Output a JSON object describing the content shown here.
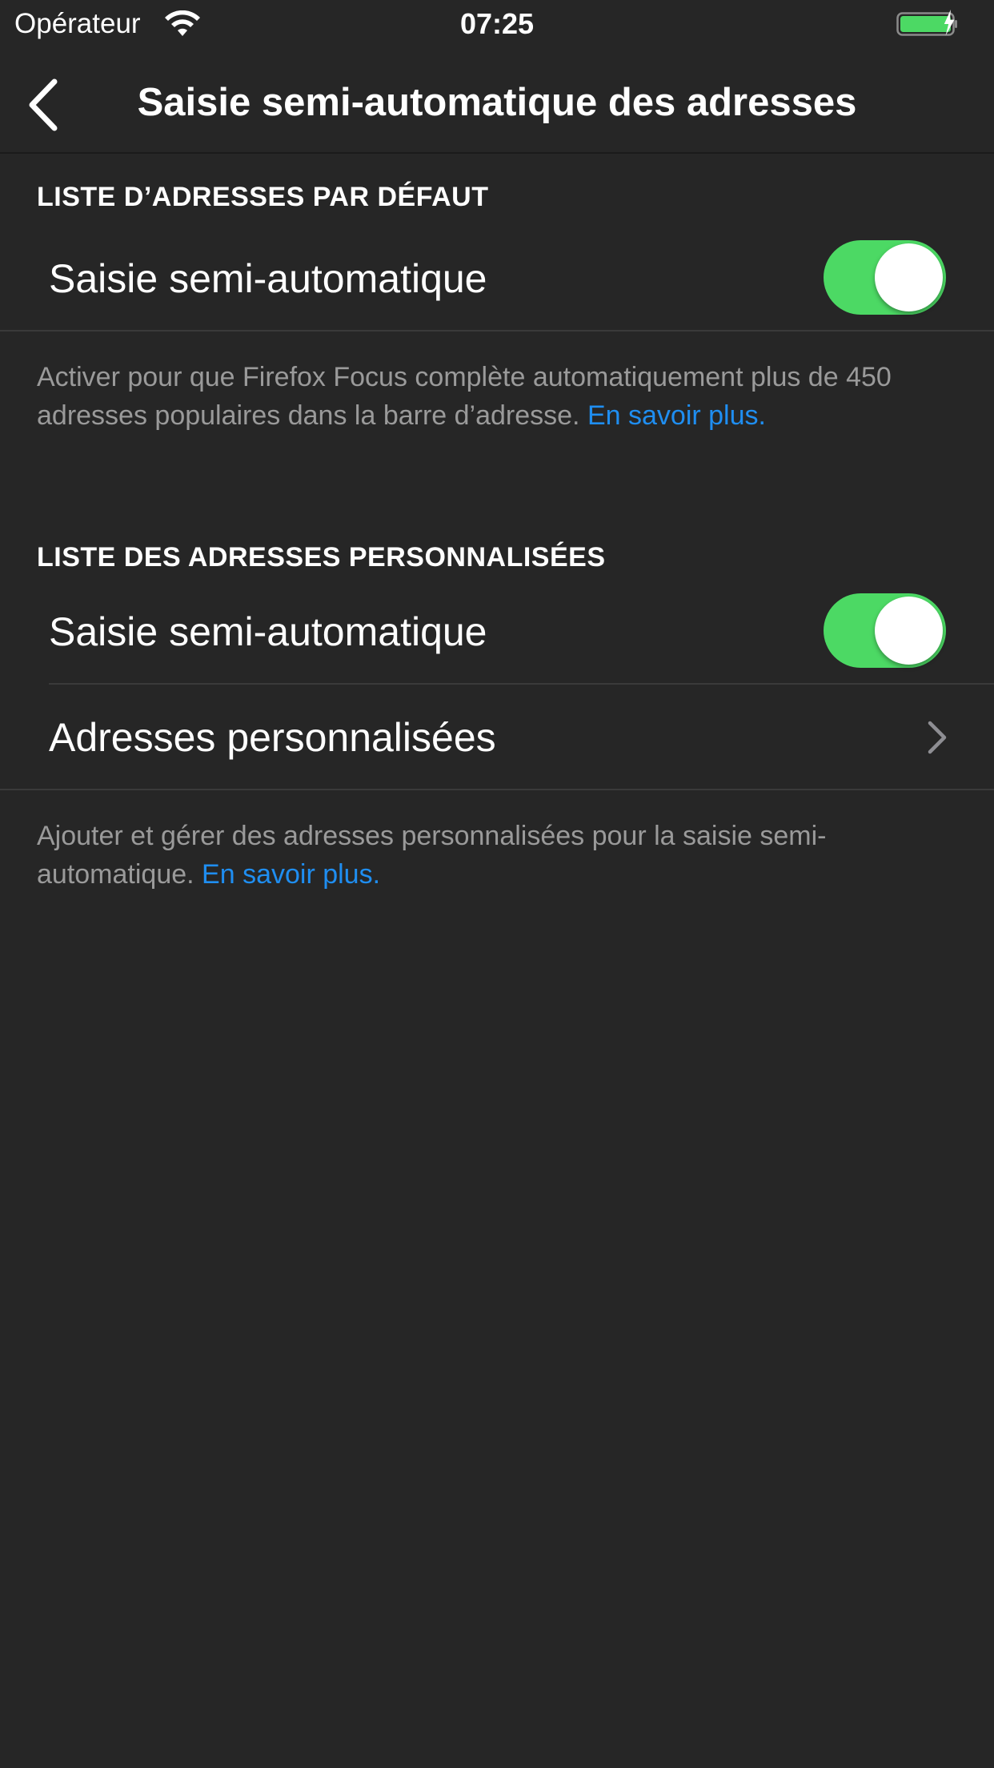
{
  "status_bar": {
    "carrier": "Opérateur",
    "time": "07:25",
    "icons": [
      "wifi-icon",
      "battery-charging-icon"
    ],
    "battery_color": "#4cd964"
  },
  "nav": {
    "title": "Saisie semi-automatique des adresses",
    "back_icon": "chevron-left-icon"
  },
  "sections": [
    {
      "header": "LISTE D’ADRESSES PAR DÉFAUT",
      "rows": [
        {
          "label": "Saisie semi-automatique",
          "type": "toggle",
          "on": true
        }
      ],
      "footer": {
        "text": "Activer pour que Firefox Focus complète automatiquement plus de 450 adresses populaires dans la barre d’adresse.",
        "link": "En savoir plus."
      }
    },
    {
      "header": "LISTE DES ADRESSES PERSONNALISÉES",
      "rows": [
        {
          "label": "Saisie semi-automatique",
          "type": "toggle",
          "on": true
        },
        {
          "label": "Adresses personnalisées",
          "type": "disclosure",
          "icon": "chevron-right-icon"
        }
      ],
      "footer": {
        "text": "Ajouter et gérer des adresses personnalisées pour la saisie semi-automatique.",
        "link": "En savoir plus."
      }
    }
  ],
  "colors": {
    "background": "#262626",
    "toggle_on": "#4cd964",
    "link": "#1f8ef1",
    "secondary_text": "#9a9a9a"
  }
}
